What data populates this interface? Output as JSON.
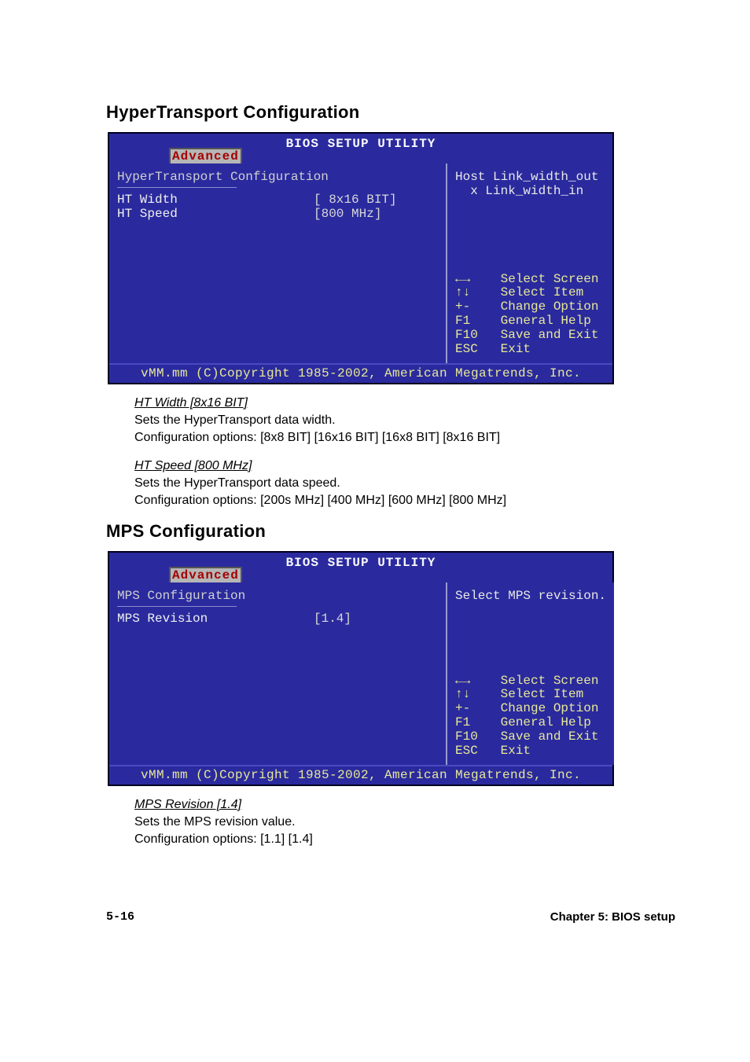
{
  "sections": {
    "ht": {
      "title": "HyperTransport Configuration",
      "bios": {
        "menutitle": "BIOS SETUP UTILITY",
        "activetab": "Advanced",
        "grouptitle": "HyperTransport Configuration",
        "rows": [
          {
            "label": "HT Width",
            "value": "[ 8x16 BIT]"
          },
          {
            "label": "HT Speed",
            "value": "[800 MHz]"
          }
        ],
        "helptop": "Host Link_width_out\n  x Link_width_in",
        "nav": "←→    Select Screen\n↑↓    Select Item\n+-    Change Option\nF1    General Help\nF10   Save and Exit\nESC   Exit",
        "footer": "vMM.mm (C)Copyright 1985-2002, American Megatrends, Inc."
      },
      "items": [
        {
          "heading": "HT Width [8x16 BIT]",
          "line1": "Sets the HyperTransport data width.",
          "line2": "Configuration options: [8x8 BIT] [16x16 BIT] [16x8 BIT] [8x16 BIT]"
        },
        {
          "heading": "HT Speed [800 MHz]",
          "line1": "Sets the HyperTransport data speed.",
          "line2": "Configuration options: [200s MHz] [400 MHz] [600 MHz] [800 MHz]"
        }
      ]
    },
    "mps": {
      "title": "MPS Configuration",
      "bios": {
        "menutitle": "BIOS SETUP UTILITY",
        "activetab": "Advanced",
        "grouptitle": "MPS Configuration",
        "rows": [
          {
            "label": "MPS Revision",
            "value": "[1.4]"
          }
        ],
        "helptop": "Select MPS revision.",
        "nav": "←→    Select Screen\n↑↓    Select Item\n+-    Change Option\nF1    General Help\nF10   Save and Exit\nESC   Exit",
        "footer": "vMM.mm (C)Copyright 1985-2002, American Megatrends, Inc."
      },
      "items": [
        {
          "heading": "MPS Revision [1.4]",
          "line1": "Sets the MPS revision value.",
          "line2": "Configuration options: [1.1] [1.4]"
        }
      ]
    }
  },
  "pagefoot": {
    "left": "5-16",
    "right": "Chapter 5: BIOS setup"
  }
}
